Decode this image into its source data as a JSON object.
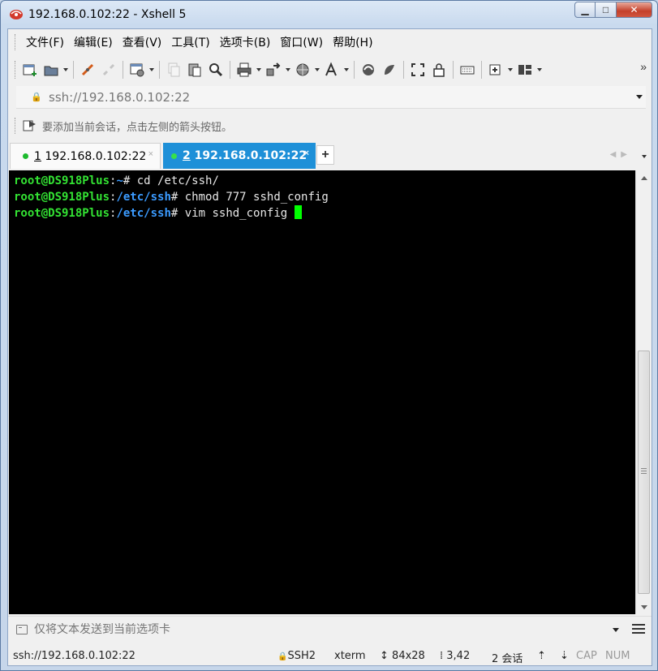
{
  "window": {
    "title": "192.168.0.102:22 - Xshell 5",
    "controls": {
      "minimize": "▁",
      "maximize": "□",
      "close": "✕"
    }
  },
  "menu": [
    "文件(F)",
    "编辑(E)",
    "查看(V)",
    "工具(T)",
    "选项卡(B)",
    "窗口(W)",
    "帮助(H)"
  ],
  "toolbar": {
    "icons": [
      "new-session-icon",
      "open-folder-icon",
      "reconnect-icon",
      "disconnect-icon",
      "properties-icon",
      "copy-icon",
      "paste-icon",
      "find-icon",
      "print-icon",
      "transfer-icon",
      "globe-icon",
      "font-icon",
      "xftp-icon",
      "xagent-icon",
      "fullscreen-icon",
      "lock-icon",
      "keyboard-icon",
      "new-tab-icon",
      "layout-icon"
    ],
    "more": "»"
  },
  "address": {
    "value": "ssh://192.168.0.102:22"
  },
  "hint": {
    "text": "要添加当前会话，点击左侧的箭头按钮。"
  },
  "tabs": [
    {
      "num": "1",
      "label": "192.168.0.102:22",
      "active": false
    },
    {
      "num": "2",
      "label": "192.168.0.102:22",
      "active": true
    }
  ],
  "tab_controls": {
    "add": "+",
    "nav": "◀▶",
    "close": "×"
  },
  "terminal": {
    "lines": [
      {
        "user": "root@DS918Plus",
        "sep": ":",
        "path": "~",
        "cmd": "# cd /etc/ssh/"
      },
      {
        "user": "root@DS918Plus",
        "sep": ":",
        "path": "/etc/ssh",
        "cmd": "# chmod 777 sshd_config"
      },
      {
        "user": "root@DS918Plus",
        "sep": ":",
        "path": "/etc/ssh",
        "cmd": "# vim sshd_config "
      }
    ],
    "colors": {
      "background": "#000000",
      "user": "#33e233",
      "path": "#3b9bff",
      "cursor": "#00ff00"
    }
  },
  "compose": {
    "placeholder": "仅将文本发送到当前选项卡"
  },
  "status": {
    "address": "ssh://192.168.0.102:22",
    "protocol": "SSH2",
    "terminal_type": "xterm",
    "size": "84x28",
    "cursor_pos": "3,42",
    "sessions": "2 会话",
    "cap": "CAP",
    "num": "NUM"
  },
  "colors": {
    "active_tab": "#1e90d8",
    "title_gradient_top": "#dce8f6"
  }
}
